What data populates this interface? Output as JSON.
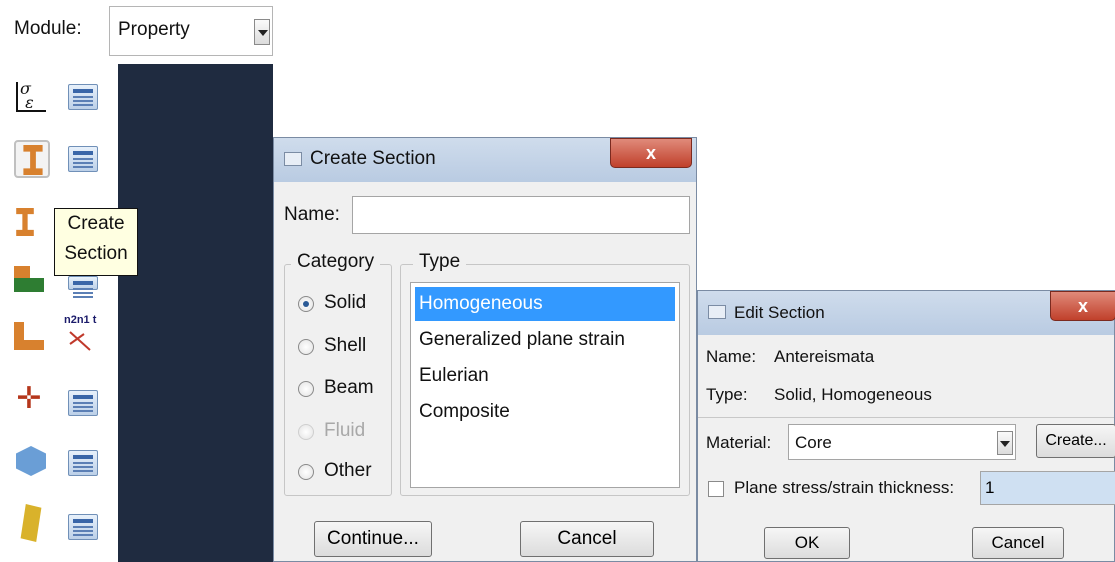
{
  "module": {
    "label": "Module:",
    "value": "Property"
  },
  "tooltip": {
    "line1": "Create",
    "line2": "Section"
  },
  "toolbox": {
    "icons": [
      "create-material-icon",
      "material-manager-icon",
      "create-section-icon",
      "section-manager-icon",
      "assign-section-icon",
      "profile-icon",
      "profile-manager-icon",
      "assign-beam-orientation-icon",
      "assign-normal-icon",
      "assign-orientation-icon",
      "orientation-manager-icon",
      "create-composite-layup-icon",
      "composite-manager-icon",
      "skin-icon",
      "skin-manager-icon"
    ],
    "orientation_text": "n2n1 t"
  },
  "create_section": {
    "title": "Create Section",
    "close_glyph": "x",
    "name_label": "Name:",
    "name_value": "",
    "category_legend": "Category",
    "category_options": [
      {
        "label": "Solid",
        "selected": true,
        "enabled": true
      },
      {
        "label": "Shell",
        "selected": false,
        "enabled": true
      },
      {
        "label": "Beam",
        "selected": false,
        "enabled": true
      },
      {
        "label": "Fluid",
        "selected": false,
        "enabled": false
      },
      {
        "label": "Other",
        "selected": false,
        "enabled": true
      }
    ],
    "type_legend": "Type",
    "type_options": [
      {
        "label": "Homogeneous",
        "selected": true
      },
      {
        "label": "Generalized plane strain",
        "selected": false
      },
      {
        "label": "Eulerian",
        "selected": false
      },
      {
        "label": "Composite",
        "selected": false
      }
    ],
    "continue_label": "Continue...",
    "cancel_label": "Cancel"
  },
  "edit_section": {
    "title": "Edit Section",
    "close_glyph": "x",
    "name_label": "Name:",
    "name_value": "Antereismata",
    "type_label": "Type:",
    "type_value": "Solid, Homogeneous",
    "material_label": "Material:",
    "material_value": "Core",
    "create_label": "Create...",
    "thickness_label": "Plane stress/strain thickness:",
    "thickness_value": "1",
    "thickness_checked": false,
    "ok_label": "OK",
    "cancel_label": "Cancel"
  },
  "colors": {
    "viewport": "#1f2b40",
    "selection": "#3399ff",
    "tooltip_bg": "#ffffe1",
    "close_button": "#c0402b"
  }
}
